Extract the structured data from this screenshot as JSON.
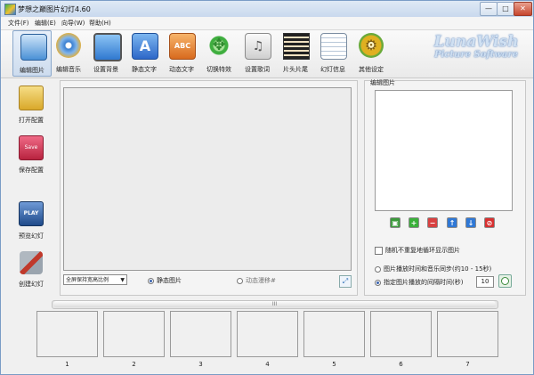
{
  "window": {
    "title": "梦想之巅图片幻灯4.60",
    "min": "—",
    "max": "□",
    "close": "✕"
  },
  "menu": [
    "文件(F)",
    "编辑(E)",
    "向导(W)",
    "帮助(H)"
  ],
  "toolbar": [
    {
      "label": "编辑图片",
      "icon": "edit-image-icon",
      "color": "#4a90d6"
    },
    {
      "label": "编辑音乐",
      "icon": "music-disc-icon",
      "color": "#3a7fd0"
    },
    {
      "label": "设置背景",
      "icon": "monitor-background-icon",
      "color": "#3f8fe0"
    },
    {
      "label": "静态文字",
      "icon": "static-text-icon",
      "color": "#3a78d8"
    },
    {
      "label": "动态文字",
      "icon": "animated-text-icon",
      "color": "#e8812a"
    },
    {
      "label": "切换特效",
      "icon": "transition-arrows-icon",
      "color": "#3fae3f"
    },
    {
      "label": "设置歌词",
      "icon": "lyrics-note-icon",
      "color": "#c9c9c9"
    },
    {
      "label": "片头片尾",
      "icon": "film-strip-icon",
      "color": "#5a4a3a"
    },
    {
      "label": "幻灯信息",
      "icon": "info-notepad-icon",
      "color": "#b8c7d8"
    },
    {
      "label": "其他设定",
      "icon": "gears-icon",
      "color": "#e0b020"
    }
  ],
  "brand": {
    "line1": "LunaWish",
    "line2": "Picture Software"
  },
  "leftbar": [
    {
      "label": "打开配置",
      "icon": "open-folder-icon",
      "color": "#e3c04a"
    },
    {
      "label": "保存配置",
      "icon": "save-disk-icon",
      "color": "#d23a5a"
    },
    {
      "label": "预览幻灯",
      "icon": "play-clapper-icon",
      "color": "#2e5fa0"
    },
    {
      "label": "创建幻灯",
      "icon": "tools-icon",
      "color": "#c0392b"
    }
  ],
  "preview": {
    "scale_option": "全屏保持宽高比例",
    "radio_static": "静态图片",
    "radio_pan": "动态漫移#"
  },
  "right": {
    "title": "编辑图片",
    "buttons": [
      {
        "icon": "fit-icon",
        "glyph": "▣",
        "color": "#3b9a3b"
      },
      {
        "icon": "add-icon",
        "glyph": "+",
        "color": "#3ab03a"
      },
      {
        "icon": "remove-icon",
        "glyph": "−",
        "color": "#d84040"
      },
      {
        "icon": "move-up-icon",
        "glyph": "↑",
        "color": "#2f78d6"
      },
      {
        "icon": "move-down-icon",
        "glyph": "↓",
        "color": "#2f78d6"
      },
      {
        "icon": "clear-icon",
        "glyph": "⊘",
        "color": "#d83030"
      }
    ],
    "random_check": "随机不重复地循环显示图片",
    "opt_sync": "图片播放时间和音乐同步(约10 - 15秒)",
    "opt_interval": "指定图片播放的间隔时间(秒)",
    "interval_value": "10"
  },
  "scroll_grip": "III",
  "thumbnails": [
    "1",
    "2",
    "3",
    "4",
    "5",
    "6",
    "7"
  ]
}
